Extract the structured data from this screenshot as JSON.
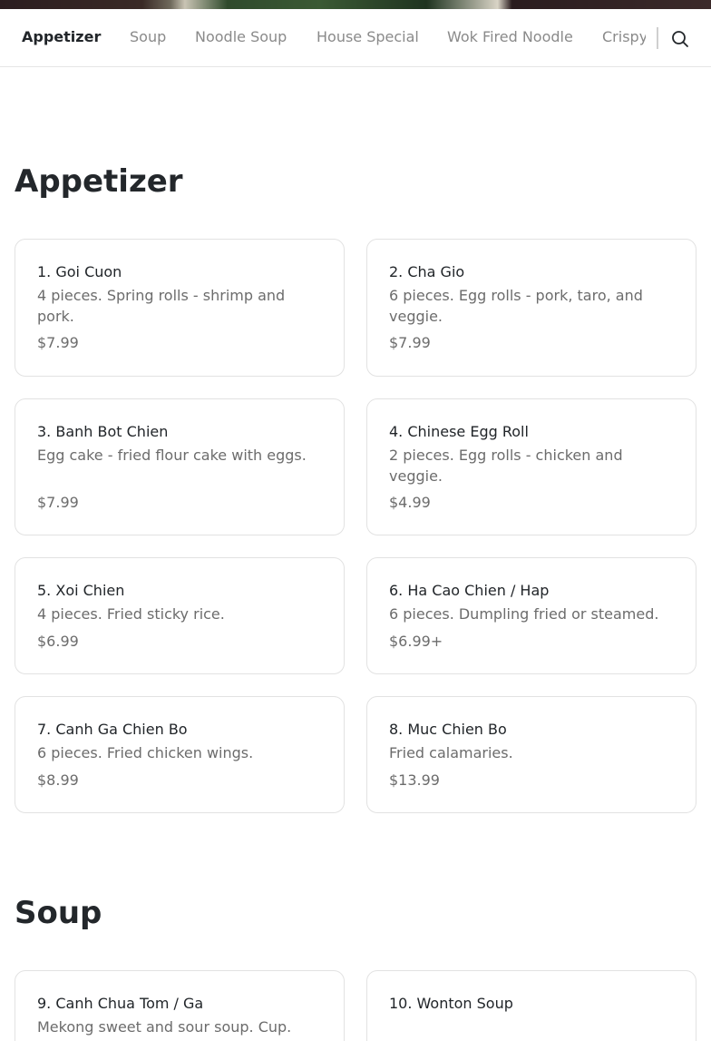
{
  "nav": {
    "tabs": [
      {
        "label": "Appetizer",
        "active": true
      },
      {
        "label": "Soup",
        "active": false
      },
      {
        "label": "Noodle Soup",
        "active": false
      },
      {
        "label": "House Special",
        "active": false
      },
      {
        "label": "Wok Fired Noodle",
        "active": false
      },
      {
        "label": "Crispy",
        "active": false
      }
    ],
    "search_icon": "search-icon"
  },
  "sections": [
    {
      "title": "Appetizer",
      "items": [
        {
          "name": "1. Goi Cuon",
          "description": "4 pieces. Spring rolls - shrimp and pork.",
          "price": "$7.99"
        },
        {
          "name": "2. Cha Gio",
          "description": "6 pieces. Egg rolls - pork, taro, and veggie.",
          "price": "$7.99"
        },
        {
          "name": "3. Banh Bot Chien",
          "description": "Egg cake - fried flour cake with eggs.",
          "price": "$7.99"
        },
        {
          "name": "4. Chinese Egg Roll",
          "description": "2 pieces. Egg rolls - chicken and veggie.",
          "price": "$4.99"
        },
        {
          "name": "5. Xoi Chien",
          "description": "4 pieces. Fried sticky rice.",
          "price": "$6.99"
        },
        {
          "name": "6. Ha Cao Chien / Hap",
          "description": "6 pieces. Dumpling fried or steamed.",
          "price": "$6.99+"
        },
        {
          "name": "7. Canh Ga Chien Bo",
          "description": "6 pieces. Fried chicken wings.",
          "price": "$8.99"
        },
        {
          "name": "8. Muc Chien Bo",
          "description": "Fried calamaries.",
          "price": "$13.99"
        }
      ]
    },
    {
      "title": "Soup",
      "items": [
        {
          "name": "9. Canh Chua Tom / Ga",
          "description": "Mekong sweet and sour soup. Cup.",
          "price": ""
        },
        {
          "name": "10. Wonton Soup",
          "description": "",
          "price": ""
        }
      ]
    }
  ]
}
